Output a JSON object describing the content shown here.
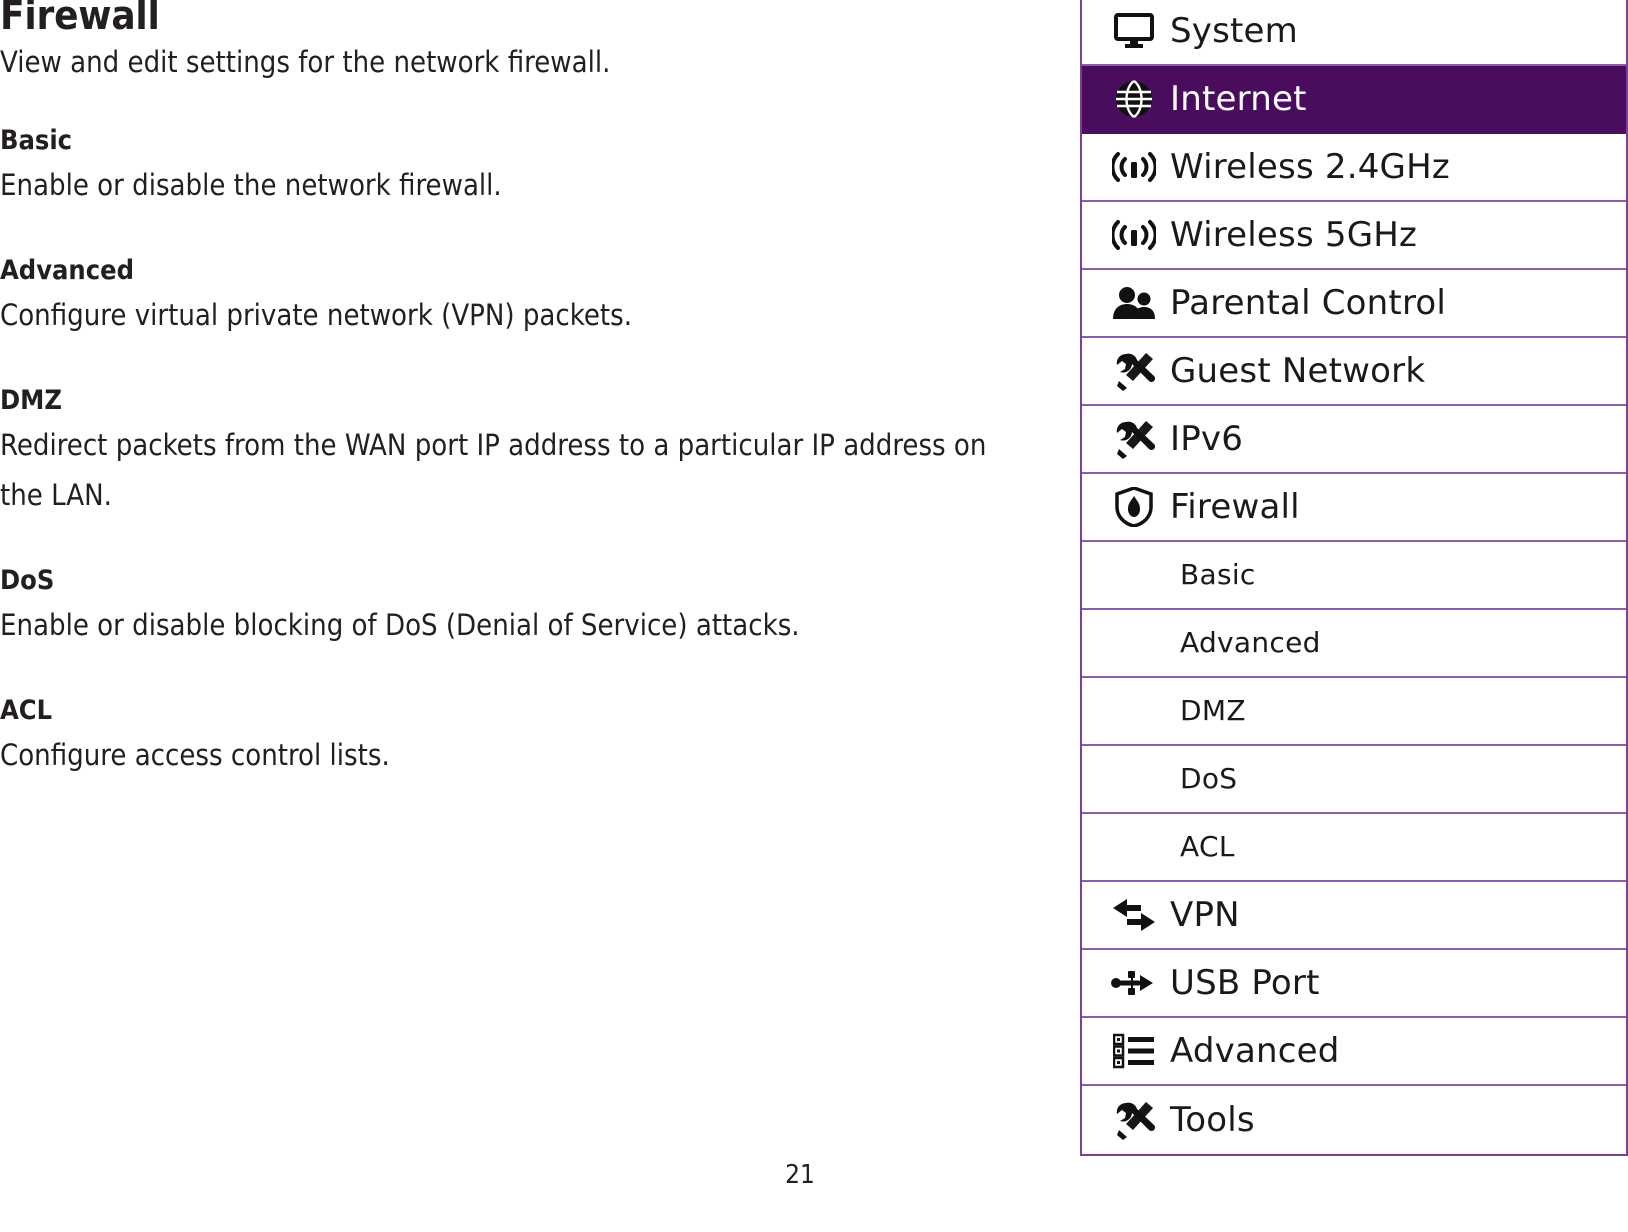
{
  "document": {
    "title": "Firewall",
    "intro": "View and edit settings for the network firewall.",
    "page_number": "21",
    "sections": [
      {
        "heading": "Basic",
        "body": "Enable or disable the network firewall."
      },
      {
        "heading": "Advanced",
        "body": "Configure virtual private network (VPN) packets."
      },
      {
        "heading": "DMZ",
        "body": "Redirect packets from the WAN port IP address to a particular IP address on the LAN."
      },
      {
        "heading": "DoS",
        "body": "Enable or disable blocking of DoS (Denial of Service) attacks."
      },
      {
        "heading": "ACL",
        "body": "Configure access control lists."
      }
    ]
  },
  "sidebar": {
    "active_item": "Internet",
    "colors": {
      "active_background": "#4a0d5e",
      "divider": "#8b5ea8",
      "border": "#7b3f98",
      "active_label": "#ffffff",
      "label": "#1a1a1a"
    },
    "items": [
      {
        "label": "System",
        "icon": "monitor-icon",
        "level": "top",
        "active": false
      },
      {
        "label": "Internet",
        "icon": "globe-icon",
        "level": "top",
        "active": true
      },
      {
        "label": "Wireless 2.4GHz",
        "icon": "wireless-signal-icon",
        "level": "top",
        "active": false
      },
      {
        "label": "Wireless 5GHz",
        "icon": "wireless-signal-icon",
        "level": "top",
        "active": false
      },
      {
        "label": "Parental Control",
        "icon": "people-icon",
        "level": "top",
        "active": false
      },
      {
        "label": "Guest Network",
        "icon": "tools-icon",
        "level": "top",
        "active": false
      },
      {
        "label": "IPv6",
        "icon": "tools-icon",
        "level": "top",
        "active": false
      },
      {
        "label": "Firewall",
        "icon": "shield-flame-icon",
        "level": "top",
        "active": false
      },
      {
        "label": "Basic",
        "icon": "",
        "level": "sub",
        "active": false
      },
      {
        "label": "Advanced",
        "icon": "",
        "level": "sub",
        "active": false
      },
      {
        "label": "DMZ",
        "icon": "",
        "level": "sub",
        "active": false
      },
      {
        "label": "DoS",
        "icon": "",
        "level": "sub",
        "active": false
      },
      {
        "label": "ACL",
        "icon": "",
        "level": "sub",
        "active": false
      },
      {
        "label": "VPN",
        "icon": "exchange-arrows-icon",
        "level": "top",
        "active": false
      },
      {
        "label": "USB Port",
        "icon": "usb-icon",
        "level": "top",
        "active": false
      },
      {
        "label": "Advanced",
        "icon": "list-icon",
        "level": "top",
        "active": false
      },
      {
        "label": "Tools",
        "icon": "tools-icon",
        "level": "top",
        "active": false
      }
    ]
  }
}
